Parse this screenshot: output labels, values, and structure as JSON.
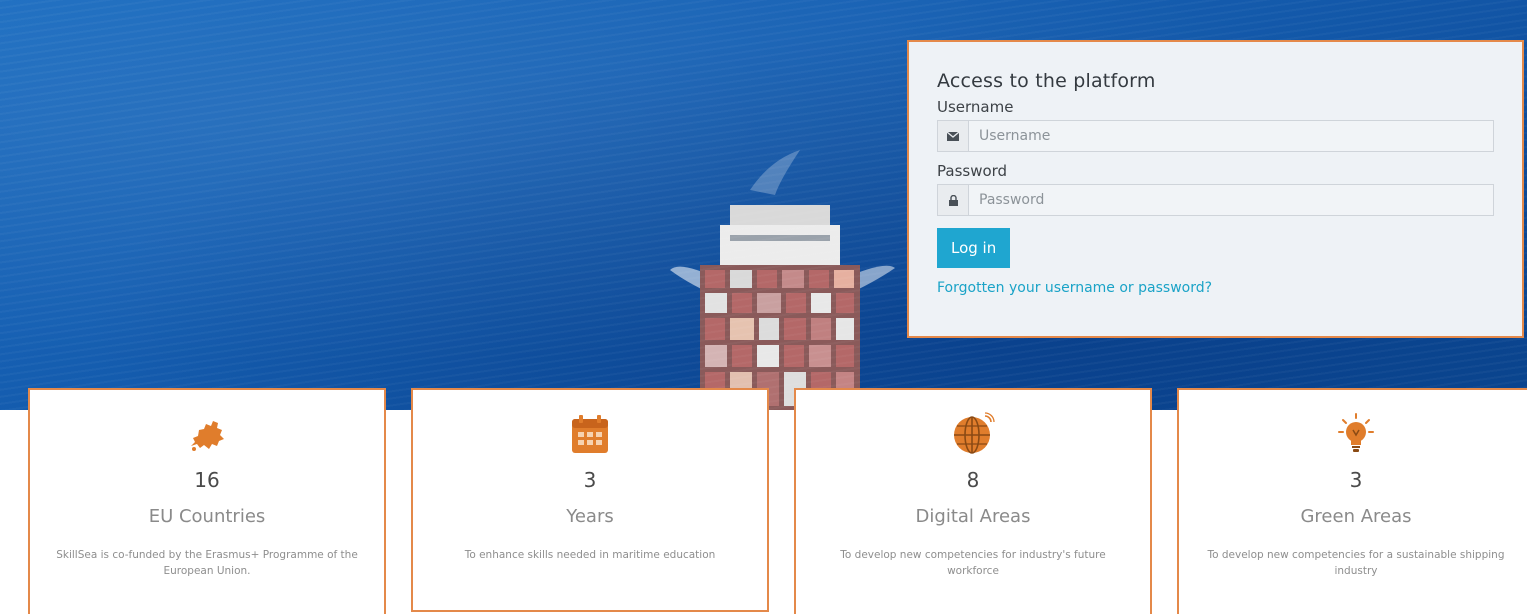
{
  "login": {
    "title": "Access to the platform",
    "username_label": "Username",
    "username_placeholder": "Username",
    "password_label": "Password",
    "password_placeholder": "Password",
    "login_button": "Log in",
    "forgot_link": "Forgotten your username or password?"
  },
  "stats": [
    {
      "icon": "europe-map-icon",
      "number": "16",
      "title": "EU Countries",
      "desc": "SkillSea is co-funded by the Erasmus+ Programme of the European Union."
    },
    {
      "icon": "calendar-icon",
      "number": "3",
      "title": "Years",
      "desc": "To enhance skills needed in maritime education"
    },
    {
      "icon": "globe-icon",
      "number": "8",
      "title": "Digital Areas",
      "desc": "To develop new competencies for industry's future workforce"
    },
    {
      "icon": "lightbulb-icon",
      "number": "3",
      "title": "Green Areas",
      "desc": "To develop new competencies for a sustainable shipping industry"
    }
  ],
  "colors": {
    "accent": "#e4894a",
    "button": "#1fa6d0",
    "link": "#1aa3c7",
    "icon": "#e07d2c"
  }
}
